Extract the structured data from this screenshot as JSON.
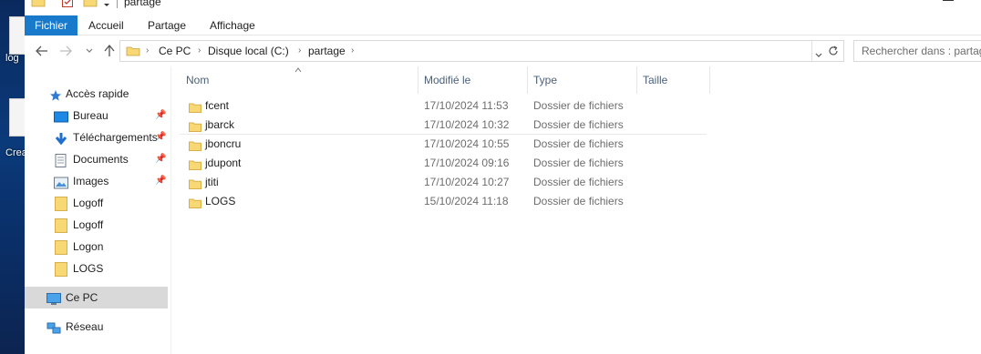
{
  "desktop": {
    "icons": [
      {
        "label": "log"
      },
      {
        "label": "Creat"
      }
    ]
  },
  "titlebar": {
    "title": "partage",
    "quick_access": [
      "folder-icon",
      "properties-icon",
      "new-folder-icon",
      "dropdown-icon"
    ]
  },
  "ribbon": {
    "tabs": [
      {
        "label": "Fichier",
        "active": true
      },
      {
        "label": "Accueil"
      },
      {
        "label": "Partage"
      },
      {
        "label": "Affichage"
      }
    ]
  },
  "address": {
    "crumbs": [
      "Ce PC",
      "Disque local (C:)",
      "partage"
    ]
  },
  "search": {
    "placeholder": "Rechercher dans : partage"
  },
  "navpane": {
    "quick_access_label": "Accès rapide",
    "items": [
      {
        "label": "Bureau",
        "icon": "desktop-icon",
        "pinned": true
      },
      {
        "label": "Téléchargements",
        "icon": "download-icon",
        "pinned": true
      },
      {
        "label": "Documents",
        "icon": "documents-icon",
        "pinned": true
      },
      {
        "label": "Images",
        "icon": "pictures-icon",
        "pinned": true
      },
      {
        "label": "Logoff",
        "icon": "folder-icon",
        "pinned": false
      },
      {
        "label": "Logoff",
        "icon": "folder-icon",
        "pinned": false
      },
      {
        "label": "Logon",
        "icon": "folder-icon",
        "pinned": false
      },
      {
        "label": "LOGS",
        "icon": "folder-icon",
        "pinned": false
      }
    ],
    "this_pc_label": "Ce PC",
    "network_label": "Réseau"
  },
  "filelist": {
    "columns": [
      "Nom",
      "Modifié le",
      "Type",
      "Taille"
    ],
    "rows": [
      {
        "name": "fcent",
        "modified": "17/10/2024 11:53",
        "type": "Dossier de fichiers",
        "size": ""
      },
      {
        "name": "jbarck",
        "modified": "17/10/2024 10:32",
        "type": "Dossier de fichiers",
        "size": ""
      },
      {
        "name": "jboncru",
        "modified": "17/10/2024 10:55",
        "type": "Dossier de fichiers",
        "size": ""
      },
      {
        "name": "jdupont",
        "modified": "17/10/2024 09:16",
        "type": "Dossier de fichiers",
        "size": ""
      },
      {
        "name": "jtiti",
        "modified": "17/10/2024 10:27",
        "type": "Dossier de fichiers",
        "size": ""
      },
      {
        "name": "LOGS",
        "modified": "15/10/2024 11:18",
        "type": "Dossier de fichiers",
        "size": ""
      }
    ]
  },
  "colors": {
    "file_tab": "#1979ca",
    "folder": "#f8d775",
    "header_text": "#4c607a",
    "selected": "#d9d9d9"
  }
}
